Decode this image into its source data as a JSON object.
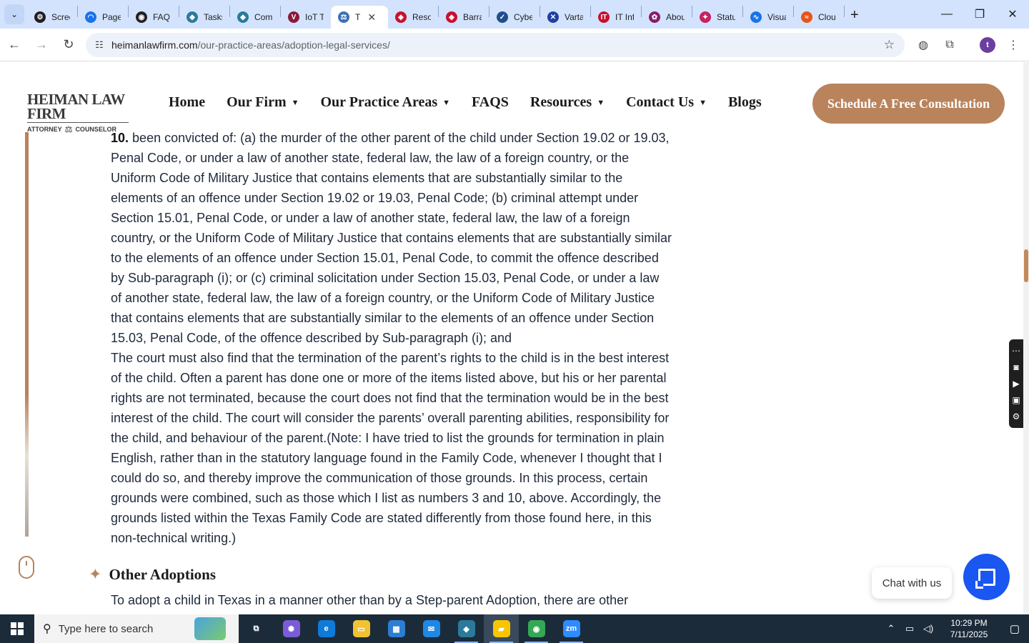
{
  "browser": {
    "tabs": [
      {
        "title": "Screen",
        "favicon_color": "#1f1f1f",
        "glyph": "⚙"
      },
      {
        "title": "Page",
        "favicon_color": "#1a73e8",
        "glyph": "◠"
      },
      {
        "title": "FAQ",
        "favicon_color": "#202124",
        "glyph": "◉"
      },
      {
        "title": "Tasks",
        "favicon_color": "#2b7a99",
        "glyph": "◆"
      },
      {
        "title": "Com",
        "favicon_color": "#2b7a99",
        "glyph": "◆"
      },
      {
        "title": "IoT T",
        "favicon_color": "#8b1a3a",
        "glyph": "V"
      },
      {
        "title": "T",
        "favicon_color": "#3b6fb6",
        "glyph": "⚖",
        "active": true
      },
      {
        "title": "Reso",
        "favicon_color": "#c8102e",
        "glyph": "◈"
      },
      {
        "title": "Barra",
        "favicon_color": "#c8102e",
        "glyph": "◈"
      },
      {
        "title": "Cybe",
        "favicon_color": "#1f4e8c",
        "glyph": "✓"
      },
      {
        "title": "Varta",
        "favicon_color": "#2040a0",
        "glyph": "✕"
      },
      {
        "title": "IT Inf",
        "favicon_color": "#c8102e",
        "glyph": "IT"
      },
      {
        "title": "Abou",
        "favicon_color": "#8b1a6b",
        "glyph": "✿"
      },
      {
        "title": "Statu",
        "favicon_color": "#c82060",
        "glyph": "✦"
      },
      {
        "title": "Visua",
        "favicon_color": "#1a73e8",
        "glyph": "∿"
      },
      {
        "title": "Clou",
        "favicon_color": "#e8531a",
        "glyph": "≈"
      }
    ],
    "url_host": "heimanlawfirm.com",
    "url_path": "/our-practice-areas/adoption-legal-services/",
    "profile_initial": "t"
  },
  "site": {
    "logo_name": "HEIMAN LAW FIRM",
    "logo_left": "ATTORNEY",
    "logo_right": "COUNSELOR",
    "nav": [
      {
        "label": "Home",
        "dropdown": false
      },
      {
        "label": "Our Firm",
        "dropdown": true
      },
      {
        "label": "Our Practice Areas",
        "dropdown": true
      },
      {
        "label": "FAQS",
        "dropdown": false
      },
      {
        "label": "Resources",
        "dropdown": true
      },
      {
        "label": "Contact Us",
        "dropdown": true
      },
      {
        "label": "Blogs",
        "dropdown": false
      }
    ],
    "cta_label": "Schedule A Free Consultation"
  },
  "content": {
    "item_number": "10.",
    "item_text": "been convicted of: (a) the murder of the other parent of the child under Section 19.02 or 19.03, Penal Code, or under a law of another state, federal law, the law of a foreign country, or the Uniform Code of Military Justice that contains elements that are substantially similar to the elements of an offence under Section 19.02 or 19.03, Penal Code; (b) criminal attempt under Section 15.01, Penal Code, or under a law of another state, federal law, the law of a foreign country, or the Uniform Code of Military Justice that contains elements that are substantially similar to the elements of an offence under Section 15.01, Penal Code, to commit the offence described by Sub-paragraph (i); or (c) criminal solicitation under Section 15.03, Penal Code, or under a law of another state, federal law, the law of a foreign country, or the Uniform Code of Military Justice that contains elements that are substantially similar to the elements of an offence under Section 15.03, Penal Code, of the offence described by Sub-paragraph (i); and",
    "paragraph": "The court must also find that the termination of the parent’s rights to the child is in the best interest of the child. Often a parent has done one or more of the items listed above, but his or her parental rights are not terminated, because the court does not find that the termination would be in the best interest of the child. The court will consider the parents’ overall parenting abilities, responsibility for the child, and behaviour of the parent.(Note: I have tried to list the grounds for termination in plain English, rather than in the statutory language found in the Family Code, whenever I thought that I could do so, and thereby improve the communication of those grounds. In this process, certain grounds were combined, such as those which I list as numbers 3 and 10, above. Accordingly, the grounds listed within the Texas Family Code are stated differently from those found here, in this non-technical writing.)",
    "section_heading": "Other Adoptions",
    "next_paragraph": "To adopt a child in Texas in a manner other than by a Step-parent Adoption, there are other"
  },
  "chat": {
    "bubble_label": "Chat with us"
  },
  "taskbar": {
    "search_placeholder": "Type here to search",
    "time": "10:29 PM",
    "date": "7/11/2025",
    "apps": [
      {
        "name": "task-view",
        "color": "transparent",
        "glyph": "⧉"
      },
      {
        "name": "copilot",
        "color": "#7b5cd6",
        "glyph": "✺"
      },
      {
        "name": "edge",
        "color": "#0f7bd8",
        "glyph": "e"
      },
      {
        "name": "file-explorer",
        "color": "#f1c232",
        "glyph": "▭"
      },
      {
        "name": "store",
        "color": "#2d7dd2",
        "glyph": "▦"
      },
      {
        "name": "mail",
        "color": "#1e88e5",
        "glyph": "✉"
      },
      {
        "name": "app-diamond",
        "color": "#2b7a99",
        "glyph": "◆"
      },
      {
        "name": "sticky-notes",
        "color": "#f7c600",
        "glyph": "▰"
      },
      {
        "name": "chrome",
        "color": "#34a853",
        "glyph": "◉"
      },
      {
        "name": "zoom",
        "color": "#2d8cff",
        "glyph": "zm"
      }
    ]
  },
  "colors": {
    "accent": "#b9835c",
    "chat_button": "#1a56f0",
    "taskbar": "#1c2b3a"
  }
}
